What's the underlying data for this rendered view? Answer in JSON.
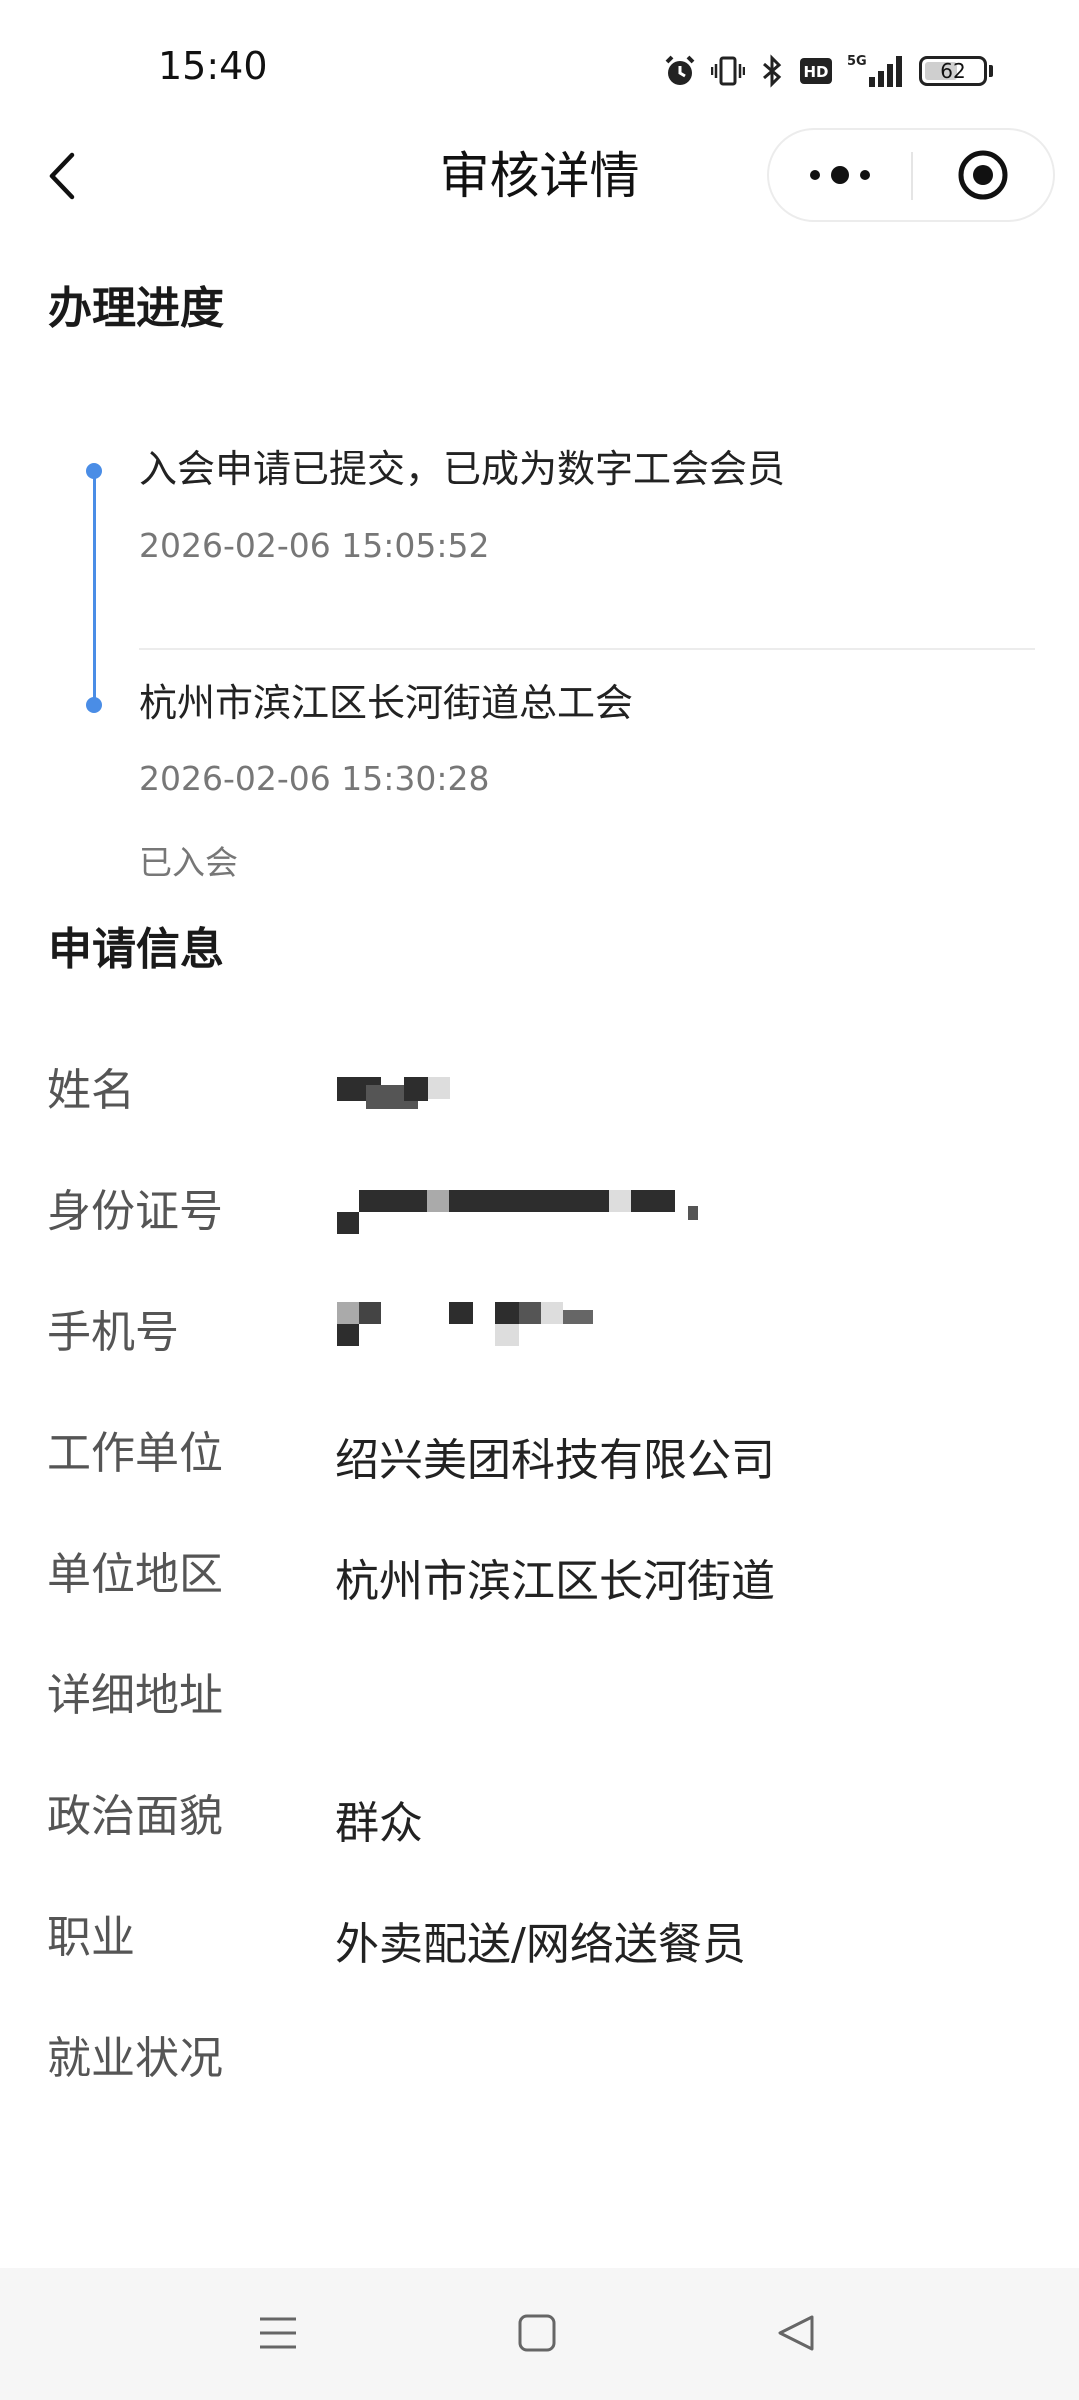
{
  "status": {
    "time": "15:40",
    "battery": "62",
    "battery_level": 0.62,
    "icons": [
      "alarm-icon",
      "vibrate-icon",
      "bluetooth-icon",
      "hd-icon",
      "5g-signal-icon",
      "battery-icon"
    ]
  },
  "nav": {
    "title": "审核详情",
    "icons": [
      "back-icon",
      "more-icon",
      "close-mini-program-icon"
    ]
  },
  "progress": {
    "title": "办理进度",
    "steps": [
      {
        "title": "入会申请已提交，已成为数字工会会员",
        "time": "2026-02-06 15:05:52"
      },
      {
        "title": "杭州市滨江区长河街道总工会",
        "time": "2026-02-06 15:30:28",
        "status": "已入会"
      }
    ]
  },
  "application": {
    "title": "申请信息",
    "fields": [
      {
        "label": "姓名",
        "value": ""
      },
      {
        "label": "身份证号",
        "value": ""
      },
      {
        "label": "手机号",
        "value": ""
      },
      {
        "label": "工作单位",
        "value": "绍兴美团科技有限公司"
      },
      {
        "label": "单位地区",
        "value": "杭州市滨江区长河街道"
      },
      {
        "label": "详细地址",
        "value": ""
      },
      {
        "label": "政治面貌",
        "value": "群众"
      },
      {
        "label": "职业",
        "value": "外卖配送/网络送餐员"
      },
      {
        "label": "就业状况",
        "value": ""
      }
    ]
  },
  "system_nav": {
    "icons": [
      "menu-icon",
      "home-icon",
      "back-triangle-icon"
    ]
  },
  "colors": {
    "accent": "#4a8de6",
    "label": "#555555",
    "secondary_text": "#777777",
    "nav_background": "#f6f6f6"
  }
}
